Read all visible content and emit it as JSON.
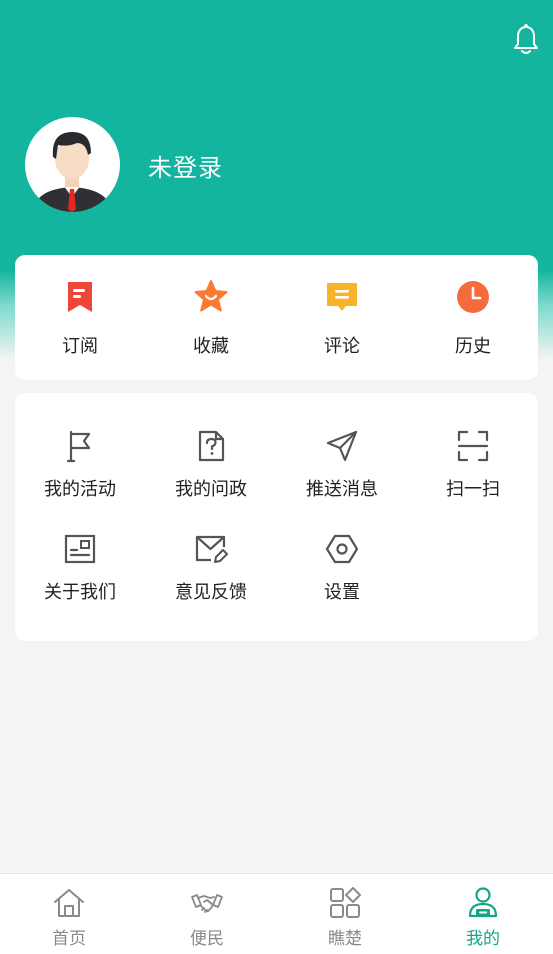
{
  "header": {
    "username": "未登录"
  },
  "quick_actions": [
    {
      "label": "订阅",
      "icon": "subscribe-bookmark-icon"
    },
    {
      "label": "收藏",
      "icon": "favorite-star-icon"
    },
    {
      "label": "评论",
      "icon": "comment-icon"
    },
    {
      "label": "历史",
      "icon": "history-clock-icon"
    }
  ],
  "tools": [
    {
      "label": "我的活动",
      "icon": "flag-icon"
    },
    {
      "label": "我的问政",
      "icon": "question-document-icon"
    },
    {
      "label": "推送消息",
      "icon": "paper-plane-icon"
    },
    {
      "label": "扫一扫",
      "icon": "scan-icon"
    },
    {
      "label": "关于我们",
      "icon": "about-card-icon"
    },
    {
      "label": "意见反馈",
      "icon": "feedback-mail-icon"
    },
    {
      "label": "设置",
      "icon": "settings-hexagon-icon"
    }
  ],
  "tabbar": {
    "items": [
      {
        "label": "首页",
        "icon": "home-icon"
      },
      {
        "label": "便民",
        "icon": "handshake-icon"
      },
      {
        "label": "瞧楚",
        "icon": "grid-apps-icon"
      },
      {
        "label": "我的",
        "icon": "profile-icon"
      }
    ],
    "active_index": 3
  },
  "colors": {
    "brand": "#13b59e",
    "active_tab": "#13a586",
    "icon_gray": "#555555"
  }
}
